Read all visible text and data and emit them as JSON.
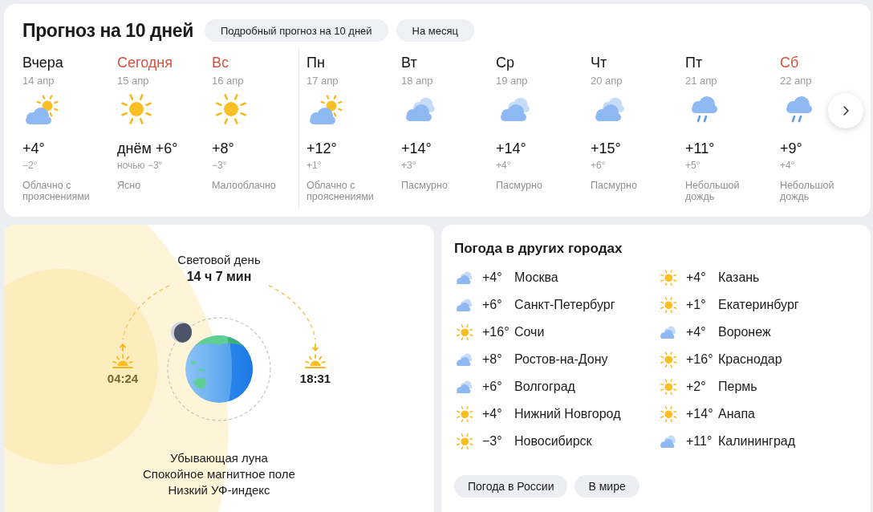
{
  "forecast": {
    "title": "Прогноз на 10 дней",
    "links": [
      "Подробный прогноз на 10 дней",
      "На месяц"
    ],
    "days": [
      {
        "day": "Вчера",
        "date": "14 апр",
        "weekend": false,
        "divider_before": false,
        "kind": "partly_cloudy",
        "temp": "+4°",
        "night": "−2°",
        "condition": "Облачно с прояснениями"
      },
      {
        "day": "Сегодня",
        "date": "15 апр",
        "weekend": true,
        "divider_before": false,
        "kind": "sunny",
        "temp": "днём +6°",
        "night": "ночью −3°",
        "condition": "Ясно"
      },
      {
        "day": "Вс",
        "date": "16 апр",
        "weekend": true,
        "divider_before": false,
        "kind": "sunny",
        "temp": "+8°",
        "night": "−3°",
        "condition": "Малооблачно"
      },
      {
        "day": "Пн",
        "date": "17 апр",
        "weekend": false,
        "divider_before": true,
        "kind": "partly_cloudy",
        "temp": "+12°",
        "night": "+1°",
        "condition": "Облачно с прояснениями"
      },
      {
        "day": "Вт",
        "date": "18 апр",
        "weekend": false,
        "divider_before": false,
        "kind": "overcast",
        "temp": "+14°",
        "night": "+3°",
        "condition": "Пасмурно"
      },
      {
        "day": "Ср",
        "date": "19 апр",
        "weekend": false,
        "divider_before": false,
        "kind": "overcast",
        "temp": "+14°",
        "night": "+4°",
        "condition": "Пасмурно"
      },
      {
        "day": "Чт",
        "date": "20 апр",
        "weekend": false,
        "divider_before": false,
        "kind": "overcast",
        "temp": "+15°",
        "night": "+6°",
        "condition": "Пасмурно"
      },
      {
        "day": "Пт",
        "date": "21 апр",
        "weekend": false,
        "divider_before": false,
        "kind": "rain",
        "temp": "+11°",
        "night": "+5°",
        "condition": "Небольшой дождь"
      },
      {
        "day": "Сб",
        "date": "22 апр",
        "weekend": true,
        "divider_before": false,
        "kind": "rain",
        "temp": "+9°",
        "night": "+4°",
        "condition": "Небольшой дождь"
      }
    ]
  },
  "astro": {
    "daylight_label": "Световой день",
    "daylight_duration": "14 ч 7 мин",
    "sunrise": "04:24",
    "sunset": "18:31",
    "notes": [
      "Убывающая луна",
      "Спокойное магнитное поле",
      "Низкий УФ-индекс"
    ]
  },
  "cities": {
    "title": "Погода в других городах",
    "columns": [
      {
        "cities": [
          {
            "kind": "overcast",
            "temp": "+4°",
            "name": "Москва"
          },
          {
            "kind": "overcast",
            "temp": "+6°",
            "name": "Санкт-Петербург"
          },
          {
            "kind": "sunny",
            "temp": "+16°",
            "name": "Сочи"
          },
          {
            "kind": "overcast",
            "temp": "+8°",
            "name": "Ростов-на-Дону"
          },
          {
            "kind": "overcast",
            "temp": "+6°",
            "name": "Волгоград"
          },
          {
            "kind": "sunny",
            "temp": "+4°",
            "name": "Нижний Новгород"
          },
          {
            "kind": "sunny",
            "temp": "−3°",
            "name": "Новосибирск"
          }
        ]
      },
      {
        "cities": [
          {
            "kind": "sunny",
            "temp": "+4°",
            "name": "Казань"
          },
          {
            "kind": "sunny",
            "temp": "+1°",
            "name": "Екатеринбург"
          },
          {
            "kind": "overcast",
            "temp": "+4°",
            "name": "Воронеж"
          },
          {
            "kind": "sunny",
            "temp": "+16°",
            "name": "Краснодар"
          },
          {
            "kind": "sunny",
            "temp": "+2°",
            "name": "Пермь"
          },
          {
            "kind": "sunny",
            "temp": "+14°",
            "name": "Анапа"
          },
          {
            "kind": "overcast",
            "temp": "+11°",
            "name": "Калининград"
          }
        ]
      }
    ],
    "buttons": [
      "Погода в России",
      "В мире"
    ]
  }
}
